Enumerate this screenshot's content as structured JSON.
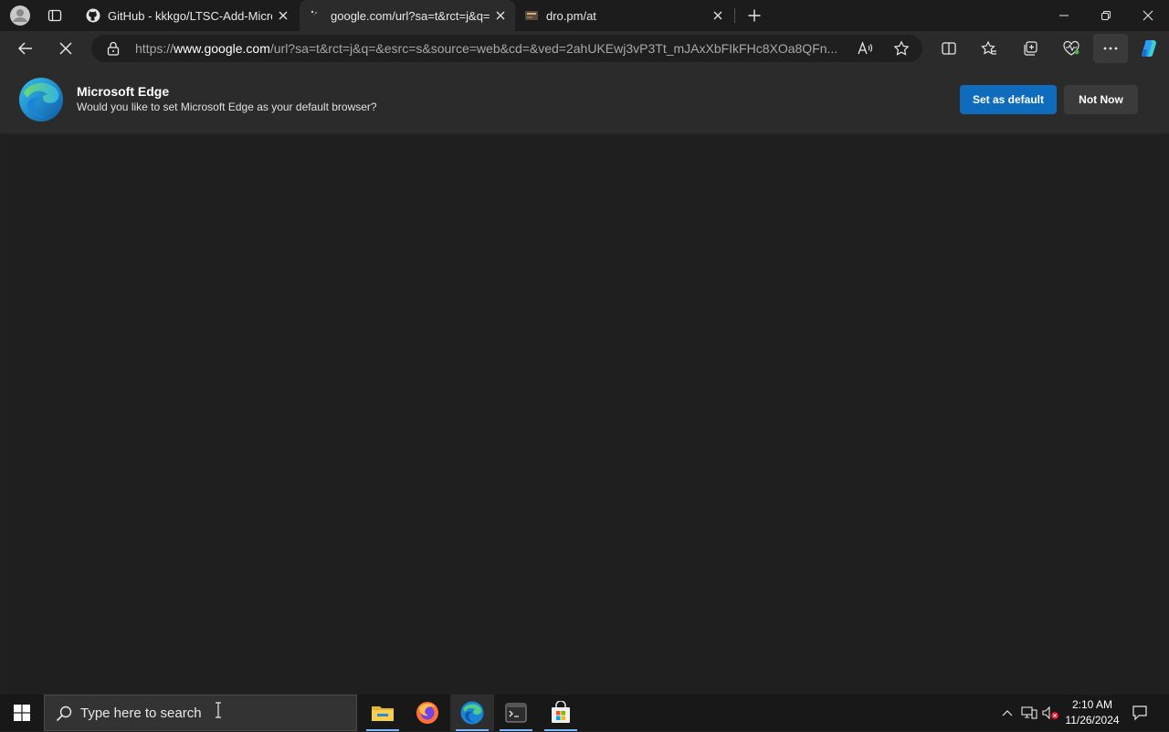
{
  "tabs": [
    {
      "title": "GitHub - kkkgo/LTSC-Add-Microsoft",
      "icon": "github-icon",
      "active": false
    },
    {
      "title": "google.com/url?sa=t&rct=j&q=&esrc",
      "icon": "loading-icon",
      "active": true
    },
    {
      "title": "dro.pm/at",
      "icon": "site-favicon",
      "active": false
    }
  ],
  "address": {
    "scheme": "https://",
    "host": "www.google.com",
    "path": "/url?sa=t&rct=j&q=&esrc=s&source=web&cd=&ved=2ahUKEwj3vP3Tt_mJAxXbFIkFHc8XOa8QFn..."
  },
  "infobar": {
    "title": "Microsoft Edge",
    "message": "Would you like to set Microsoft Edge as your default browser?",
    "primary_button": "Set as default",
    "secondary_button": "Not Now"
  },
  "taskbar": {
    "search_placeholder": "Type here to search",
    "time": "2:10 AM",
    "date": "11/26/2024",
    "apps": [
      "file-explorer",
      "firefox",
      "edge",
      "terminal",
      "store"
    ]
  },
  "colors": {
    "accent": "#0f6cbd",
    "taskbar_highlight": "#77b7ff"
  }
}
